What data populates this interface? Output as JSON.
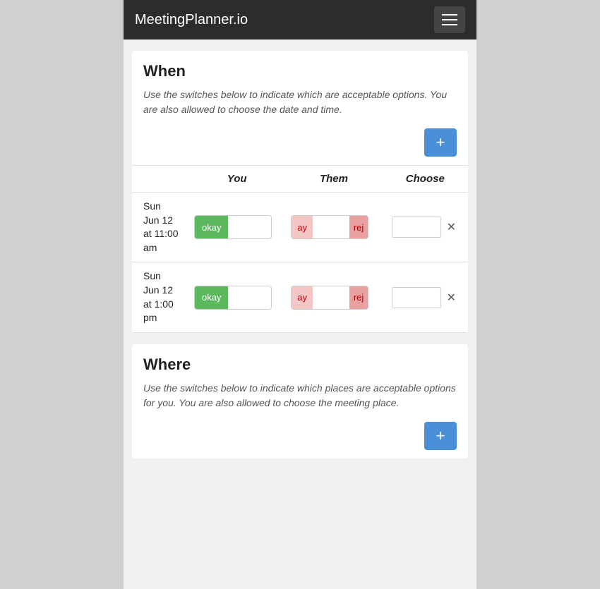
{
  "header": {
    "title": "MeetingPlanner.io",
    "menu_button_label": "Menu"
  },
  "when_section": {
    "title": "When",
    "description": "Use the switches below to indicate which are acceptable options.  You are also allowed to choose the date and time.",
    "add_button_label": "+",
    "table_headers": {
      "you": "You",
      "them": "Them",
      "choose": "Choose"
    },
    "rows": [
      {
        "date": "Sun Jun 12 at 11:00 am",
        "you_status": "okay",
        "them_left": "ay",
        "them_right": "rej",
        "choose_value": ""
      },
      {
        "date": "Sun Jun 12 at 1:00 pm",
        "you_status": "okay",
        "them_left": "ay",
        "them_right": "rej",
        "choose_value": ""
      }
    ]
  },
  "where_section": {
    "title": "Where",
    "description": "Use the switches below to indicate which places are acceptable options for you.  You are also allowed to choose the meeting place.",
    "add_button_label": "+"
  }
}
